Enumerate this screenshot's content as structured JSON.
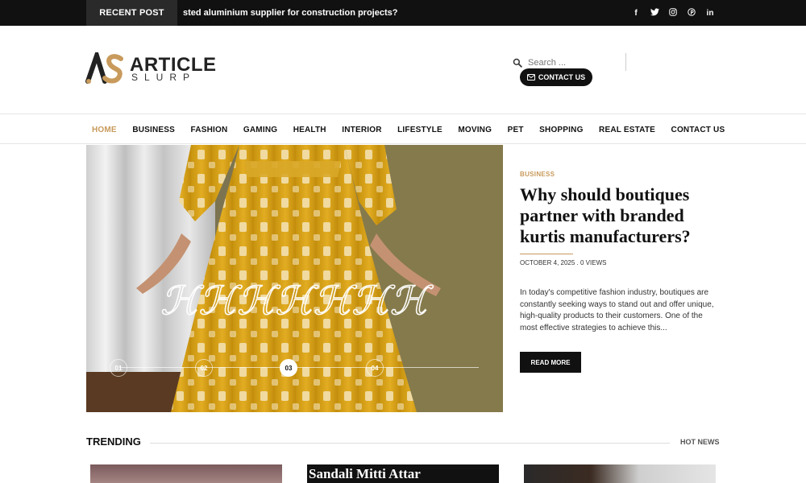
{
  "topbar": {
    "recent_label": "RECENT POST",
    "ticker_text": "sted aluminium supplier for construction projects?",
    "social": [
      "facebook-icon",
      "twitter-icon",
      "instagram-icon",
      "pinterest-icon",
      "linkedin-icon"
    ]
  },
  "header": {
    "logo_title": "ARTICLE",
    "logo_sub": "SLURP",
    "search_placeholder": "Search ...",
    "contact_label": "CONTACT US"
  },
  "nav": {
    "items": [
      "HOME",
      "BUSINESS",
      "FASHION",
      "GAMING",
      "HEALTH",
      "INTERIOR",
      "LIFESTYLE",
      "MOVING",
      "PET",
      "SHOPPING",
      "REAL ESTATE",
      "CONTACT US"
    ],
    "active": "HOME"
  },
  "hero": {
    "slides": [
      "01",
      "02",
      "03",
      "04"
    ],
    "active_slide": "03"
  },
  "article": {
    "category": "BUSINESS",
    "title": "Why should boutiques partner with branded kurtis manufacturers?",
    "meta": "OCTOBER 4, 2025 . 0 VIEWS",
    "excerpt": "In today's competitive fashion industry, boutiques are constantly seeking ways to stand out and offer unique, high-quality products to their customers. One of the most effective strategies to achieve this...",
    "read_more": "READ MORE"
  },
  "trending": {
    "label": "TRENDING",
    "hot_news": "HOT NEWS",
    "card2_text": "Sandali Mitti Attar"
  },
  "colors": {
    "accent": "#c89a5c",
    "dark": "#111111"
  }
}
